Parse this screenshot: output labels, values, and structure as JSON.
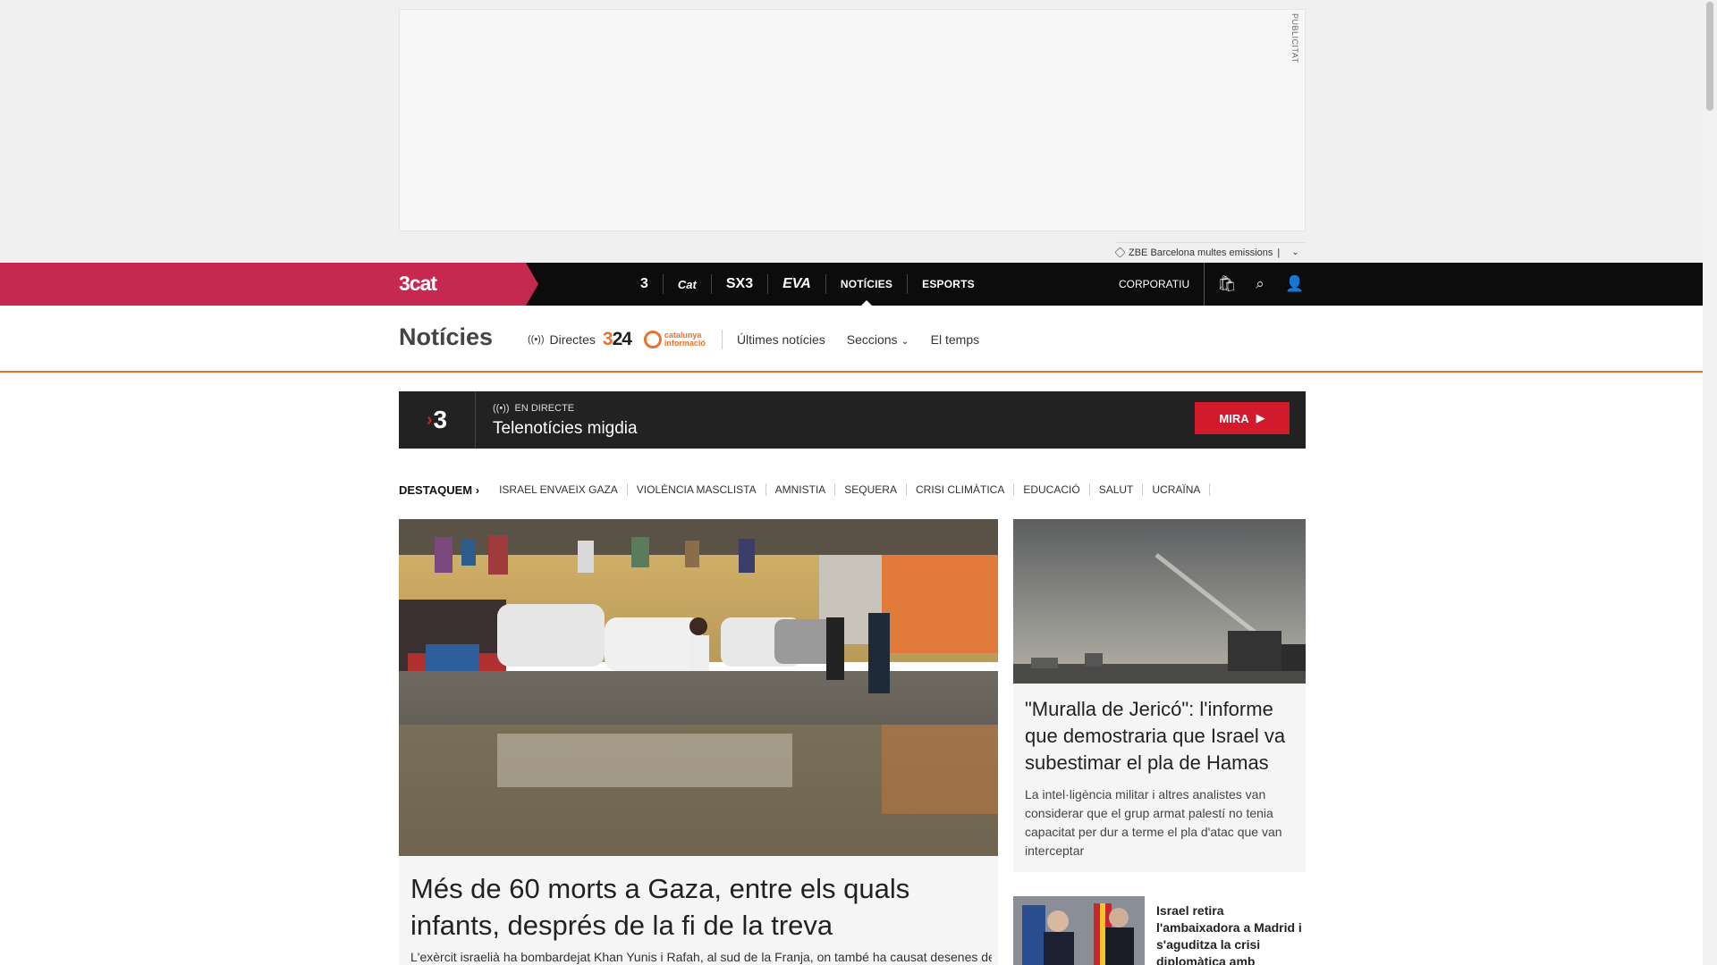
{
  "ad": {
    "label": "PUBLICITAT",
    "topic_chip": "ZBE Barcelona multes emissions",
    "separator": "|"
  },
  "topbar": {
    "logo": "3cat",
    "channels": [
      {
        "label": "3",
        "name": "channel-tv3"
      },
      {
        "label": "Cat",
        "name": "channel-catradio"
      },
      {
        "label": "SX3",
        "name": "channel-sx3"
      },
      {
        "label": "EVA",
        "name": "channel-eva"
      },
      {
        "label": "NOTÍCIES",
        "name": "channel-noticies"
      },
      {
        "label": "ESPORTS",
        "name": "channel-esports"
      }
    ],
    "corporate": "CORPORATIU"
  },
  "section_nav": {
    "title": "Notícies",
    "directes": "Directes",
    "logo_324": "3/24",
    "logo_ci_top": "catalunya",
    "logo_ci_bottom": "informació",
    "items": [
      "Últimes notícies",
      "Seccions",
      "El temps"
    ]
  },
  "live": {
    "channel": "3",
    "tag": "EN DIRECTE",
    "title": "Telenotícies migdia",
    "cta": "MIRA"
  },
  "trending": {
    "label": "DESTAQUEM",
    "tags": [
      "ISRAEL ENVAEIX GAZA",
      "VIOLÈNCIA MASCLISTA",
      "AMNISTIA",
      "SEQUERA",
      "CRISI CLIMÀTICA",
      "EDUCACIÓ",
      "SALUT",
      "UCRAÏNA"
    ]
  },
  "main_story": {
    "headline": "Més de 60 morts a Gaza, entre els quals infants, després de la fi de la treva",
    "lead": "L'exèrcit israelià ha bombardejat Khan Yunis i Rafah, al sud de la Franja, on també ha causat desenes de"
  },
  "side_story": {
    "headline": "\"Muralla de Jericó\": l'informe que demostraria que Israel va subestimar el pla de Hamas",
    "lead": "La intel·ligència militar i altres analistes van considerar que el grup armat palestí no tenia capacitat per dur a terme el pla d'atac que van interceptar"
  },
  "small_story": {
    "headline": "Israel retira l'ambaixadora a Madrid i s'aguditza la crisi diplomàtica amb"
  },
  "colors": {
    "brand_pink": "#c6284f",
    "accent_orange": "#e8722f",
    "cta_red": "#d11b2d",
    "bar_black": "#0c0c0c"
  }
}
